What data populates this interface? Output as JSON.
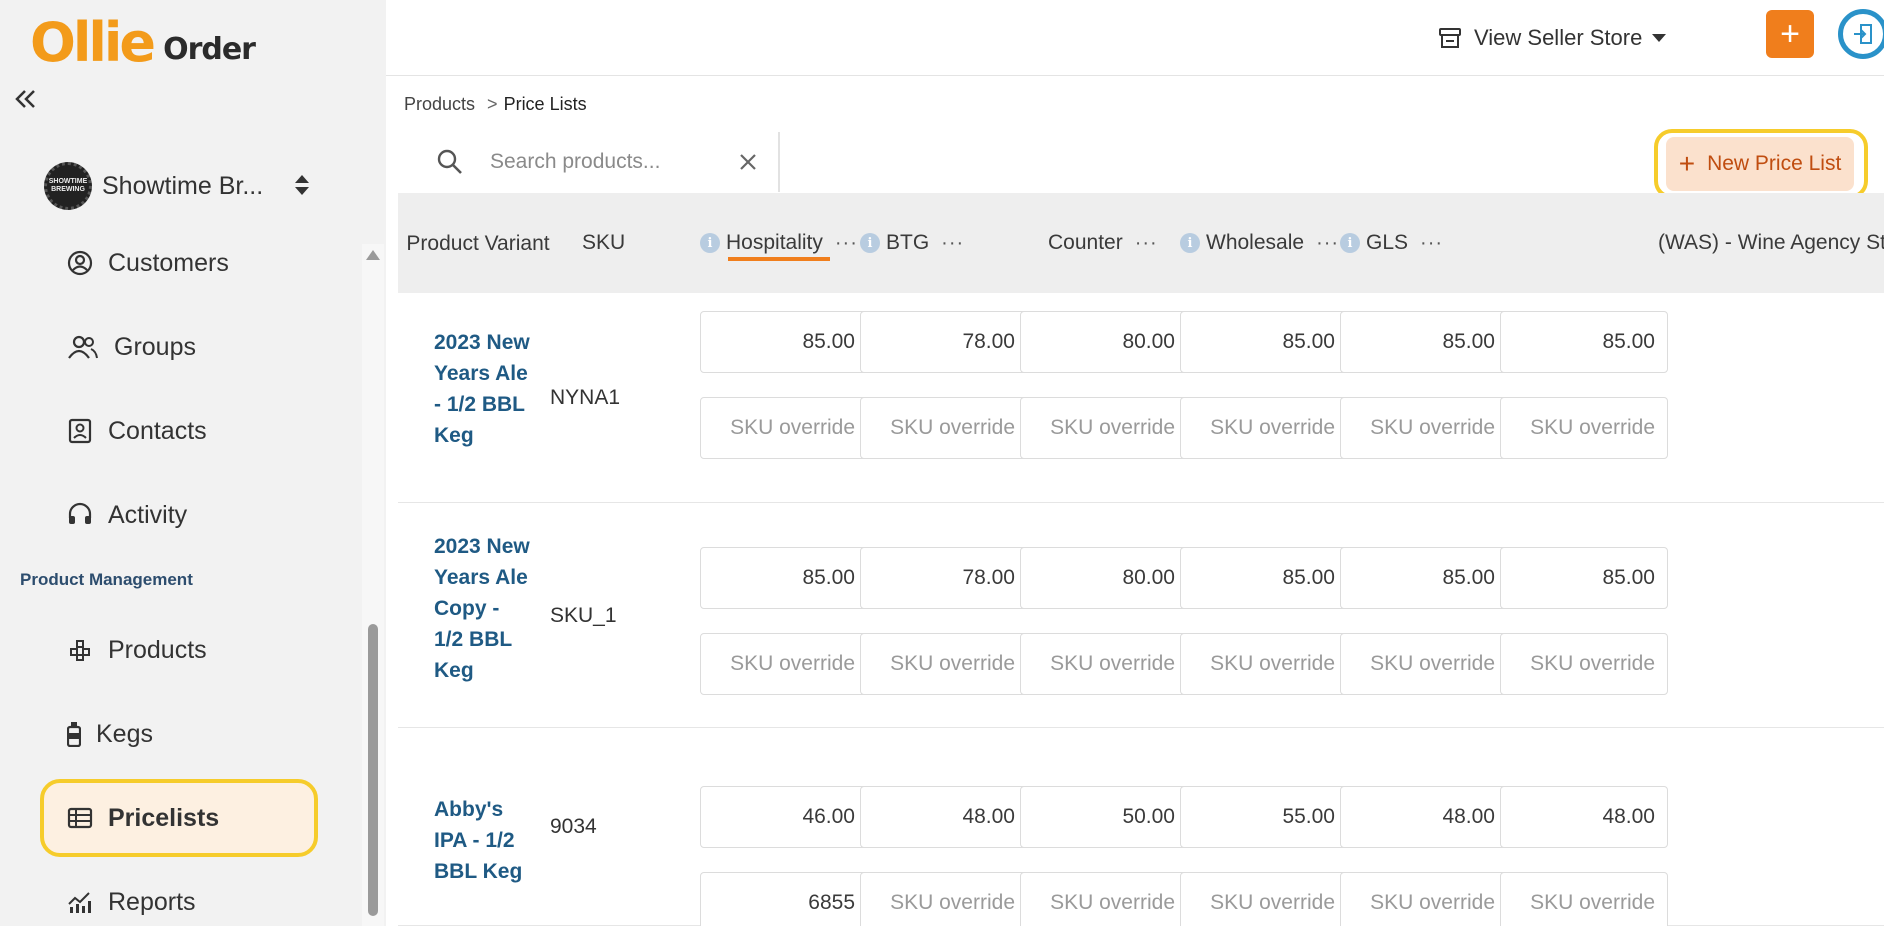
{
  "brand": {
    "logo_main": "Ollie",
    "logo_sub": "Order",
    "store_name": "Showtime Br...",
    "avatar_text": "SHOWTIME BREWING"
  },
  "sidebar": {
    "items": [
      {
        "label": "Customers",
        "icon": "user-circle-icon"
      },
      {
        "label": "Groups",
        "icon": "users-icon"
      },
      {
        "label": "Contacts",
        "icon": "contact-card-icon"
      },
      {
        "label": "Activity",
        "icon": "headset-icon"
      }
    ],
    "section_label": "Product Management",
    "pm_items": [
      {
        "label": "Products",
        "icon": "boxes-icon"
      },
      {
        "label": "Kegs",
        "icon": "keg-icon"
      },
      {
        "label": "Pricelists",
        "icon": "table-icon",
        "active": true
      },
      {
        "label": "Reports",
        "icon": "chart-icon"
      }
    ]
  },
  "topbar": {
    "store_label": "View Seller Store",
    "add_label": "+"
  },
  "breadcrumb": {
    "parent": "Products",
    "separator": ">",
    "current": "Price Lists"
  },
  "search": {
    "placeholder": "Search products...",
    "value": ""
  },
  "actions": {
    "new_price_list": "New Price List"
  },
  "table": {
    "headers": {
      "product_variant": "Product Variant",
      "sku": "SKU",
      "columns": [
        "Hospitality",
        "BTG",
        "Counter",
        "Wholesale",
        "GLS",
        "(WAS) - Wine Agency St"
      ],
      "menu_dots": "···",
      "info": "i"
    },
    "override_placeholder": "SKU override",
    "rows": [
      {
        "name": "2023 New Years Ale - 1/2 BBL Keg",
        "sku": "NYNA1",
        "prices": [
          "85.00",
          "78.00",
          "80.00",
          "85.00",
          "85.00",
          "85.00"
        ],
        "overrides": [
          "",
          "",
          "",
          "",
          "",
          ""
        ]
      },
      {
        "name": "2023 New Years Ale Copy - 1/2 BBL Keg",
        "sku": "SKU_1",
        "prices": [
          "85.00",
          "78.00",
          "80.00",
          "85.00",
          "85.00",
          "85.00"
        ],
        "overrides": [
          "",
          "",
          "",
          "",
          "",
          ""
        ]
      },
      {
        "name": "Abby's IPA - 1/2 BBL Keg",
        "sku": "9034",
        "prices": [
          "46.00",
          "48.00",
          "50.00",
          "55.00",
          "48.00",
          "48.00"
        ],
        "overrides": [
          "6855",
          "",
          "",
          "",
          "",
          ""
        ]
      }
    ]
  },
  "colors": {
    "accent": "#f07e1c",
    "highlight": "#f6cc2b",
    "link": "#1f5a84",
    "logo": "#f39b1a"
  }
}
